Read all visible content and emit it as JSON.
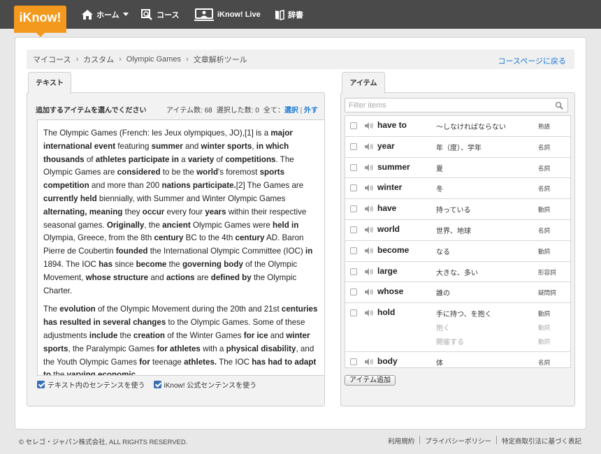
{
  "nav": {
    "logo": "iKnow!",
    "home": "ホーム",
    "course": "コース",
    "live": "iKnow! Live",
    "dictionary": "辞書"
  },
  "breadcrumb": [
    "マイコース",
    "カスタム",
    "Olympic Games",
    "文章解析ツール"
  ],
  "course_page_link": "コースページに戻る",
  "left_panel": {
    "tab": "テキスト",
    "title": "追加するアイテムを選んでください",
    "items_count_label": "アイテム数: 68",
    "selected_count_label": "選択した数: 0",
    "all_label": "全て：",
    "select_label": "選択",
    "separator": "|",
    "deselect_label": "外す",
    "paragraphs": [
      [
        {
          "t": "The Olympic Games (French: les Jeux olympiques, JO),[1] is a "
        },
        {
          "t": "major international event",
          "b": true
        },
        {
          "t": " featuring "
        },
        {
          "t": "summer",
          "b": true
        },
        {
          "t": " and "
        },
        {
          "t": "winter sports",
          "b": true
        },
        {
          "t": ", "
        },
        {
          "t": "in which thousands",
          "b": true
        },
        {
          "t": " of "
        },
        {
          "t": "athletes participate in",
          "b": true
        },
        {
          "t": " a "
        },
        {
          "t": "variety",
          "b": true
        },
        {
          "t": " of "
        },
        {
          "t": "competitions",
          "b": true
        },
        {
          "t": ". The Olympic Games are "
        },
        {
          "t": "considered",
          "b": true
        },
        {
          "t": " to be the "
        },
        {
          "t": "world",
          "b": true
        },
        {
          "t": "'s foremost "
        },
        {
          "t": "sports competition",
          "b": true
        },
        {
          "t": " and more than 200 "
        },
        {
          "t": "nations participate.",
          "b": true
        },
        {
          "t": "[2] The Games are "
        },
        {
          "t": "currently held",
          "b": true
        },
        {
          "t": " biennially, with Summer and Winter Olympic Games "
        },
        {
          "t": "alternating, meaning",
          "b": true
        },
        {
          "t": " they "
        },
        {
          "t": "occur",
          "b": true
        },
        {
          "t": " every four "
        },
        {
          "t": "years",
          "b": true
        },
        {
          "t": " within their respective seasonal games. "
        },
        {
          "t": "Originally",
          "b": true
        },
        {
          "t": ", the "
        },
        {
          "t": "ancient",
          "b": true
        },
        {
          "t": " Olympic Games were "
        },
        {
          "t": "held in",
          "b": true
        },
        {
          "t": " Olympia, Greece, from the 8th "
        },
        {
          "t": "century",
          "b": true
        },
        {
          "t": " BC to the 4th "
        },
        {
          "t": "century",
          "b": true
        },
        {
          "t": " AD. Baron Pierre de Coubertin "
        },
        {
          "t": "founded",
          "b": true
        },
        {
          "t": " the International Olympic Committee (IOC) "
        },
        {
          "t": "in",
          "b": true
        },
        {
          "t": " 1894. The IOC "
        },
        {
          "t": "has",
          "b": true
        },
        {
          "t": " since "
        },
        {
          "t": "become",
          "b": true
        },
        {
          "t": " the "
        },
        {
          "t": "governing body",
          "b": true
        },
        {
          "t": " of the Olympic Movement, "
        },
        {
          "t": "whose structure",
          "b": true
        },
        {
          "t": " and "
        },
        {
          "t": "actions",
          "b": true
        },
        {
          "t": " are "
        },
        {
          "t": "defined by",
          "b": true
        },
        {
          "t": " the Olympic Charter."
        }
      ],
      [
        {
          "t": "The "
        },
        {
          "t": "evolution",
          "b": true
        },
        {
          "t": " of the Olympic Movement during the 20th and 21st "
        },
        {
          "t": "centuries has resulted in several changes",
          "b": true
        },
        {
          "t": " to the Olympic Games. Some of these adjustments "
        },
        {
          "t": "include",
          "b": true
        },
        {
          "t": " the "
        },
        {
          "t": "creation",
          "b": true
        },
        {
          "t": " of the Winter Games "
        },
        {
          "t": "for ice",
          "b": true
        },
        {
          "t": " and "
        },
        {
          "t": "winter sports",
          "b": true
        },
        {
          "t": ", the Paralympic Games "
        },
        {
          "t": "for athletes",
          "b": true
        },
        {
          "t": " with a "
        },
        {
          "t": "physical disability",
          "b": true
        },
        {
          "t": ", and the Youth Olympic Games "
        },
        {
          "t": "for",
          "b": true
        },
        {
          "t": " teenage "
        },
        {
          "t": "athletes.",
          "b": true
        },
        {
          "t": " The IOC "
        },
        {
          "t": "has had to adapt to",
          "b": true
        },
        {
          "t": " the "
        },
        {
          "t": "varying economic,",
          "b": true
        }
      ]
    ],
    "checkbox_text_sentences": "テキスト内のセンテンスを使う",
    "checkbox_official_sentences": "iKnow! 公式センテンスを使う"
  },
  "right_panel": {
    "tab": "アイテム",
    "filter_placeholder": "Filter items",
    "items": [
      {
        "word": "have to",
        "meanings": [
          {
            "m": "〜しなければならない",
            "p": "熟語"
          }
        ]
      },
      {
        "word": "year",
        "meanings": [
          {
            "m": "年（度）、学年",
            "p": "名詞"
          }
        ]
      },
      {
        "word": "summer",
        "meanings": [
          {
            "m": "夏",
            "p": "名詞"
          }
        ]
      },
      {
        "word": "winter",
        "meanings": [
          {
            "m": "冬",
            "p": "名詞"
          }
        ]
      },
      {
        "word": "have",
        "meanings": [
          {
            "m": "持っている",
            "p": "動詞"
          }
        ]
      },
      {
        "word": "world",
        "meanings": [
          {
            "m": "世界、地球",
            "p": "名詞"
          }
        ]
      },
      {
        "word": "become",
        "meanings": [
          {
            "m": "なる",
            "p": "動詞"
          }
        ]
      },
      {
        "word": "large",
        "meanings": [
          {
            "m": "大きな、多い",
            "p": "形容詞"
          }
        ]
      },
      {
        "word": "whose",
        "meanings": [
          {
            "m": "誰の",
            "p": "疑問詞"
          }
        ]
      },
      {
        "word": "hold",
        "meanings": [
          {
            "m": "手に持つ、を抱く",
            "p": "動詞"
          },
          {
            "m": "抱く",
            "p": "動詞",
            "dim": true
          },
          {
            "m": "開催する",
            "p": "動詞",
            "dim": true
          }
        ]
      },
      {
        "word": "body",
        "meanings": [
          {
            "m": "体",
            "p": "名詞"
          }
        ]
      }
    ],
    "add_button": "アイテム追加"
  },
  "footer": {
    "copyright": "© セレゴ・ジャパン株式会社, ALL RIGHTS RESERVED.",
    "links": [
      "利用規約",
      "プライバシーポリシー",
      "特定商取引法に基づく表記"
    ]
  },
  "colors": {
    "accent_orange": "#f39a1e",
    "link_blue": "#1a7ad4",
    "topbar": "#4a4a4a"
  }
}
